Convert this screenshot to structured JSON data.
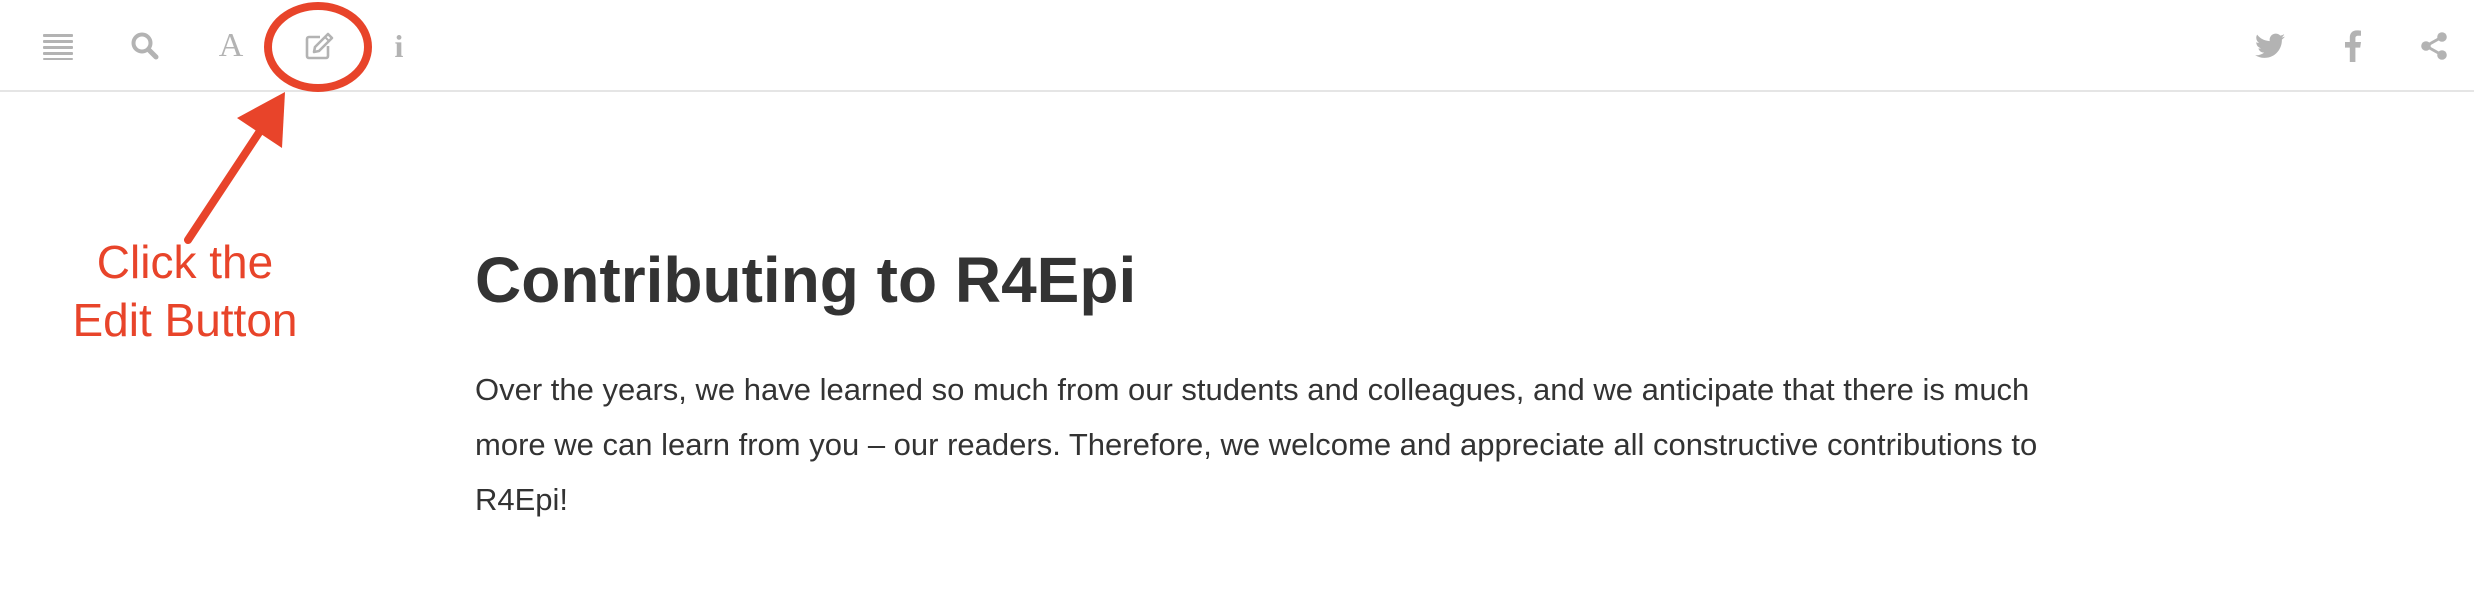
{
  "toolbar": {
    "left_icons": [
      "toc-icon",
      "search-icon",
      "font-settings-icon",
      "edit-icon",
      "info-icon"
    ],
    "right_icons": [
      "twitter-icon",
      "facebook-icon",
      "share-icon"
    ],
    "font_glyph": "A",
    "info_glyph": "i",
    "icon_color": "#b3b3b3"
  },
  "annotation": {
    "line1": "Click the",
    "line2": "Edit Button",
    "color": "#e8442a"
  },
  "main": {
    "title": "Contributing to R4Epi",
    "paragraph": "Over the years, we have learned so much from our students and colleagues, and we anticipate that there is much more we can learn from you – our readers. Therefore, we welcome and appreciate all constructive contributions to R4Epi!",
    "text_color": "#333333"
  }
}
